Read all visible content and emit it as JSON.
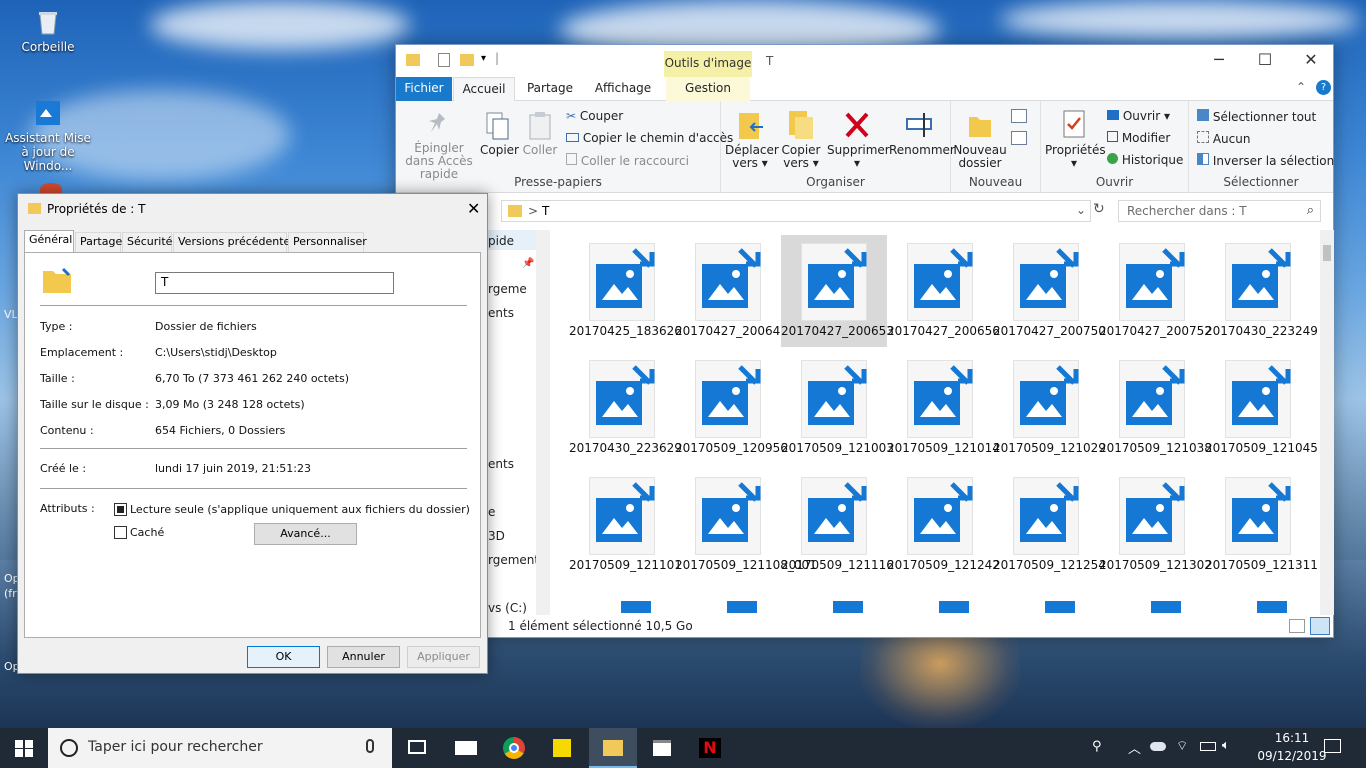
{
  "desktop": {
    "icons": [
      {
        "label": "Corbeille"
      },
      {
        "label": "Assistant Mise à jour de Windo..."
      }
    ],
    "partial_labels": [
      "VL",
      "Op",
      "(fr",
      "Op"
    ]
  },
  "explorer": {
    "quick_access_sep": "|",
    "context_header": "Outils d'image",
    "title": "T",
    "tabs": [
      "Fichier",
      "Accueil",
      "Partage",
      "Affichage",
      "Gestion"
    ],
    "ribbon": {
      "groups": [
        "Presse-papiers",
        "Organiser",
        "Nouveau",
        "Ouvrir",
        "Sélectionner"
      ],
      "epingler": "Épingler dans Accès rapide",
      "copier": "Copier",
      "coller": "Coller",
      "couper": "Couper",
      "copier_chemin": "Copier le chemin d'accès",
      "coller_raccourci": "Coller le raccourci",
      "deplacer": "Déplacer vers",
      "copier_vers": "Copier vers",
      "supprimer": "Supprimer",
      "renommer": "Renommer",
      "nouveau_dossier": "Nouveau dossier",
      "proprietes": "Propriétés",
      "ouvrir": "Ouvrir",
      "modifier": "Modifier",
      "historique": "Historique",
      "selectionner_tout": "Sélectionner tout",
      "aucun": "Aucun",
      "inverser": "Inverser la sélection"
    },
    "address": {
      "sep": ">",
      "path": "T"
    },
    "search_placeholder": "Rechercher dans : T",
    "nav_items": [
      "pide",
      "rgeme",
      "ents",
      "ents",
      "e",
      "3D",
      "rgement",
      "vs (C:)"
    ],
    "files": [
      "20170425_183626",
      "20170427_200646",
      "20170427_200653",
      "20170427_200656",
      "20170427_200750",
      "20170427_200752",
      "20170430_223249",
      "20170430_223629",
      "20170509_120956",
      "20170509_121003",
      "20170509_121014",
      "20170509_121029",
      "20170509_121038",
      "20170509_121045",
      "20170509_121101",
      "20170509_121108_001",
      "20170509_121116",
      "20170509_121242",
      "20170509_121254",
      "20170509_121302",
      "20170509_121311"
    ],
    "selected_file": "20170427_200653",
    "status": "1 élément sélectionné  10,5 Go"
  },
  "props": {
    "title": "Propriétés de : T",
    "tabs": [
      "Général",
      "Partage",
      "Sécurité",
      "Versions précédentes",
      "Personnaliser"
    ],
    "name_value": "T",
    "rows": [
      {
        "label": "Type :",
        "value": "Dossier de fichiers"
      },
      {
        "label": "Emplacement :",
        "value": "C:\\Users\\stidj\\Desktop"
      },
      {
        "label": "Taille :",
        "value": "6,70 To (7 373 461 262 240 octets)"
      },
      {
        "label": "Taille sur le disque :",
        "value": "3,09 Mo (3 248 128 octets)"
      },
      {
        "label": "Contenu :",
        "value": "654 Fichiers, 0 Dossiers"
      },
      {
        "label": "Créé le :",
        "value": "lundi 17 juin 2019, 21:51:23"
      }
    ],
    "attributes_label": "Attributs :",
    "readonly_label": "Lecture seule (s'applique uniquement aux fichiers du dossier)",
    "hidden_label": "Caché",
    "advanced_button": "Avancé...",
    "ok": "OK",
    "cancel": "Annuler",
    "apply": "Appliquer"
  },
  "taskbar": {
    "search_placeholder": "Taper ici pour rechercher",
    "time": "16:11",
    "date": "09/12/2019"
  }
}
